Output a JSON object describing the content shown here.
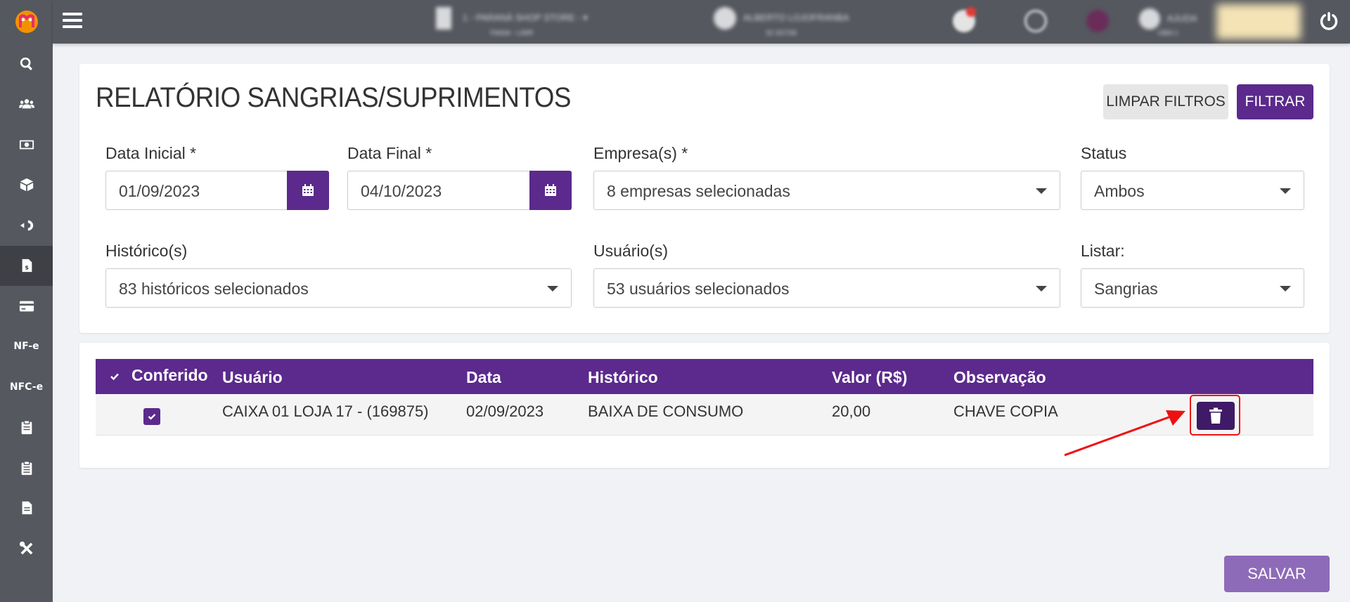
{
  "app": {
    "logo_icon": "app-logo-icon",
    "accent": "#5b2a8c",
    "sidebar_bg": "#55585f"
  },
  "sidebar": {
    "items": [
      {
        "icon": "search-icon",
        "label": ""
      },
      {
        "icon": "users-icon",
        "label": ""
      },
      {
        "icon": "money-icon",
        "label": ""
      },
      {
        "icon": "box-icon",
        "label": ""
      },
      {
        "icon": "exchange-icon",
        "label": ""
      },
      {
        "icon": "report-money-icon",
        "label": ""
      },
      {
        "icon": "credit-card-icon",
        "label": ""
      },
      {
        "icon": "",
        "label": "NF-e"
      },
      {
        "icon": "",
        "label": "NFC-e"
      },
      {
        "icon": "clipboard-icon",
        "label": ""
      },
      {
        "icon": "clipboard-check-icon",
        "label": ""
      },
      {
        "icon": "document-icon",
        "label": ""
      },
      {
        "icon": "tools-icon",
        "label": ""
      }
    ]
  },
  "topbar": {
    "store": "1 - PARANÁ SHOP STORE -",
    "store_sub": "FANIA - LIMR",
    "user": "ALBERTO LOJOFRANBA",
    "user_sub": "ID 337/39",
    "help": "AJUDA",
    "help_sub": "OBA 1"
  },
  "page": {
    "title": "RELATÓRIO SANGRIAS/SUPRIMENTOS",
    "clear_button": "LIMPAR FILTROS",
    "filter_button": "FILTRAR",
    "save_button": "SALVAR"
  },
  "filters": {
    "start_date": {
      "label": "Data Inicial *",
      "value": "01/09/2023"
    },
    "end_date": {
      "label": "Data Final *",
      "value": "04/10/2023"
    },
    "companies": {
      "label": "Empresa(s) *",
      "value": "8 empresas selecionadas"
    },
    "status": {
      "label": "Status",
      "value": "Ambos"
    },
    "histories": {
      "label": "Histórico(s)",
      "value": "83 históricos selecionados"
    },
    "users": {
      "label": "Usuário(s)",
      "value": "53 usuários selecionados"
    },
    "list": {
      "label": "Listar:",
      "value": "Sangrias"
    }
  },
  "table": {
    "columns": {
      "checked": "Conferido",
      "user": "Usuário",
      "date": "Data",
      "history": "Histórico",
      "value": "Valor (R$)",
      "note": "Observação"
    },
    "rows": [
      {
        "checked": true,
        "user": "CAIXA 01 LOJA 17 - (169875)",
        "date": "02/09/2023",
        "history": "BAIXA DE CONSUMO",
        "value": "20,00",
        "note": "CHAVE COPIA"
      }
    ]
  }
}
